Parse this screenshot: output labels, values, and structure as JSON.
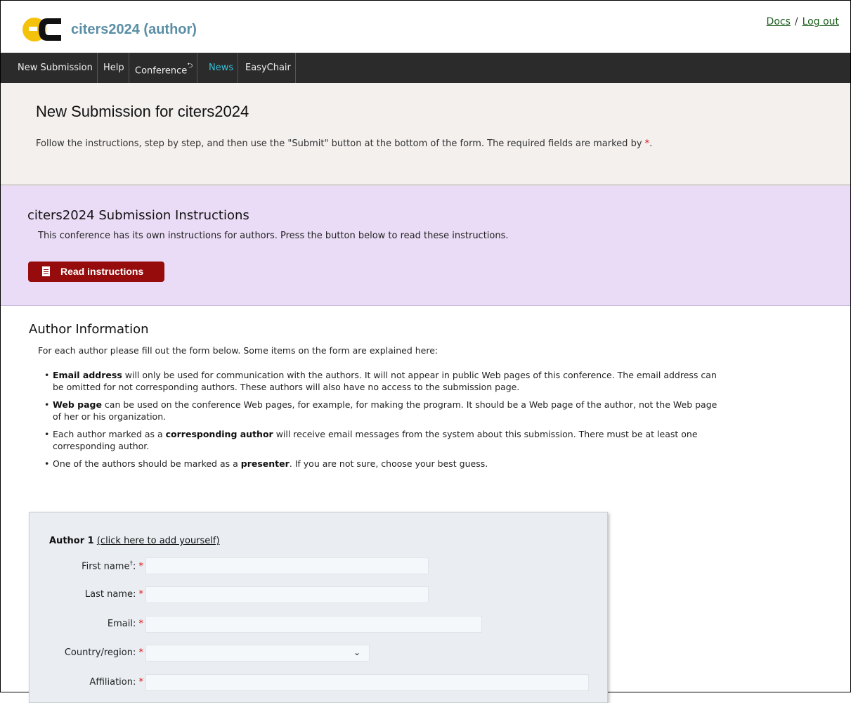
{
  "header": {
    "title": "citers2024 (author)",
    "docs": "Docs",
    "sep": "/",
    "logout": "Log out"
  },
  "menu": {
    "new_submission": "New Submission",
    "help": "Help",
    "conference": "Conference",
    "news": "News",
    "easychair": "EasyChair"
  },
  "page": {
    "title": "New Submission for citers2024",
    "intro": "Follow the instructions, step by step, and then use the \"Submit\" button at the bottom of the form. The required fields are marked by",
    "req_mark": "*",
    "period": "."
  },
  "instructions": {
    "title": "citers2024 Submission Instructions",
    "text": "This conference has its own instructions for authors. Press the button below to read these instructions.",
    "button": "Read instructions"
  },
  "author_info": {
    "title": "Author Information",
    "intro": "For each author please fill out the form below. Some items on the form are explained here:",
    "bullets": [
      {
        "pre": "",
        "bold": "Email address",
        "post": " will only be used for communication with the authors. It will not appear in public Web pages of this conference. The email address can be omitted for not corresponding authors. These authors will also have no access to the submission page."
      },
      {
        "pre": "",
        "bold": "Web page",
        "post": " can be used on the conference Web pages, for example, for making the program. It should be a Web page of the author, not the Web page of her or his organization."
      },
      {
        "pre": "Each author marked as a ",
        "bold": "corresponding author",
        "post": " will receive email messages from the system about this submission. There must be at least one corresponding author."
      },
      {
        "pre": "One of the authors should be marked as a ",
        "bold": "presenter",
        "post": ". If you are not sure, choose your best guess."
      }
    ]
  },
  "author1": {
    "heading": "Author 1",
    "add_self": "(click here to add yourself)",
    "fields": {
      "first_name": {
        "label": "First name",
        "dagger": "†",
        "colon": ":",
        "value": ""
      },
      "last_name": {
        "label": "Last name:",
        "value": ""
      },
      "email": {
        "label": "Email:",
        "value": ""
      },
      "country": {
        "label": "Country/region:",
        "value": ""
      },
      "affiliation": {
        "label": "Affiliation:",
        "value": ""
      }
    }
  }
}
